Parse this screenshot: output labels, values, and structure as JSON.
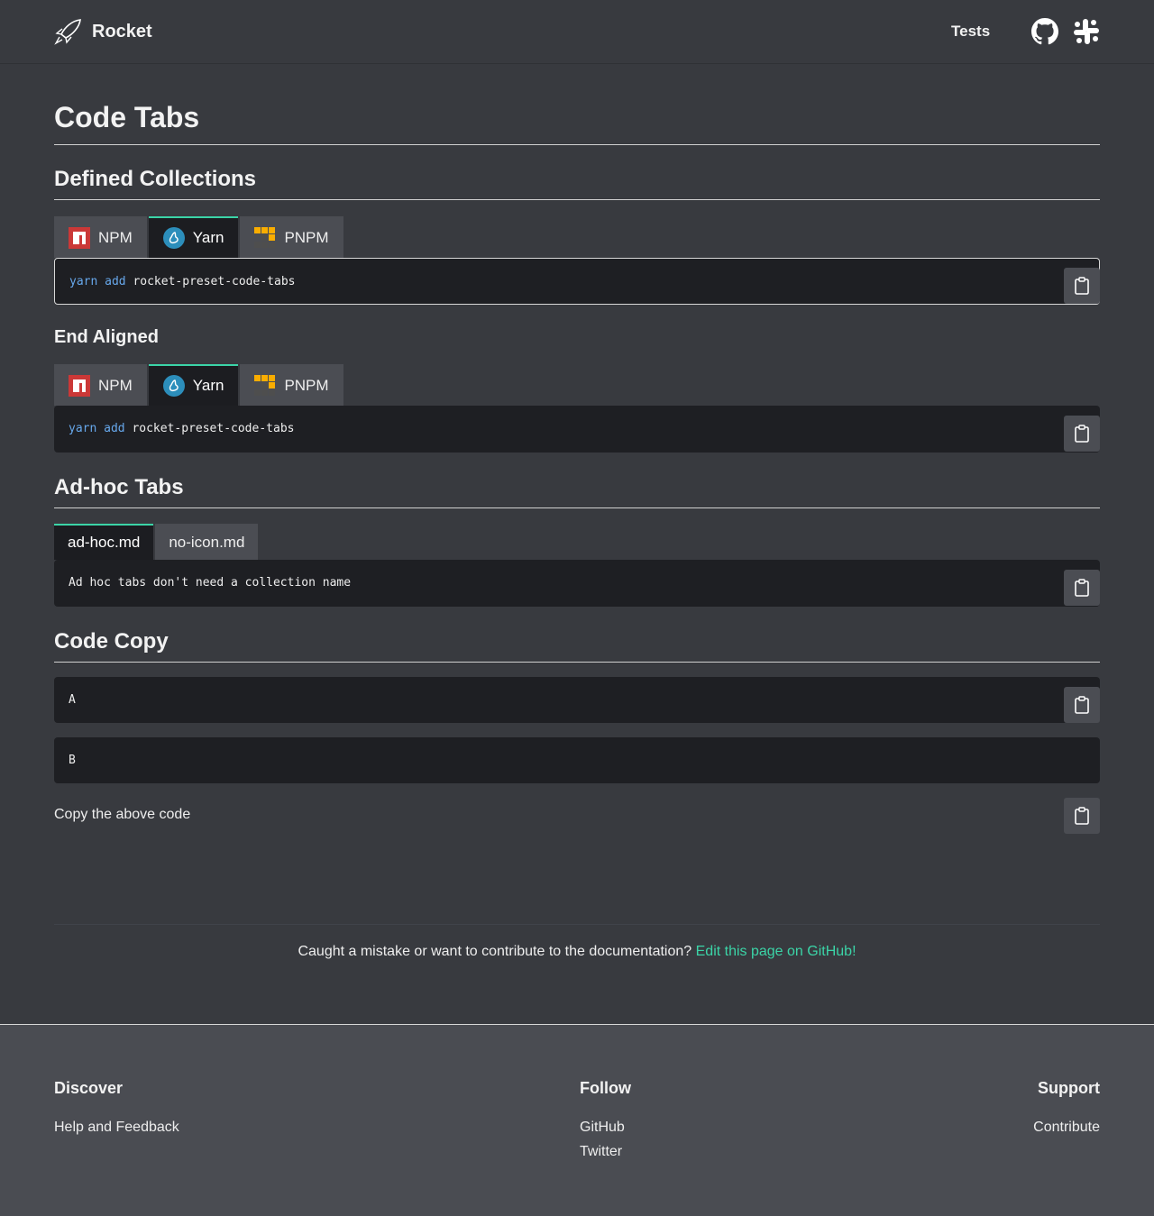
{
  "header": {
    "brand": "Rocket",
    "nav_tests": "Tests",
    "icons": [
      "rocket-logo-icon",
      "github-icon",
      "slack-icon"
    ]
  },
  "page": {
    "title": "Code Tabs",
    "sections": {
      "defined_collections": "Defined Collections",
      "end_aligned": "End Aligned",
      "adhoc_tabs": "Ad-hoc Tabs",
      "code_copy": "Code Copy"
    }
  },
  "collections_tabs": {
    "npm": "NPM",
    "yarn": "Yarn",
    "pnpm": "PNPM",
    "active": "Yarn"
  },
  "yarn_command": {
    "cmd": "yarn",
    "sub": "add",
    "pkg": "rocket-preset-code-tabs"
  },
  "adhoc": {
    "tab1": "ad-hoc.md",
    "tab2": "no-icon.md",
    "content": "Ad hoc tabs don't need a collection name"
  },
  "code_copy": {
    "block_a": "A",
    "block_b": "B",
    "copy_text": "Copy the above code"
  },
  "contribute": {
    "text": "Caught a mistake or want to contribute to the documentation?",
    "link": "Edit this page on GitHub!"
  },
  "footer": {
    "discover": {
      "title": "Discover",
      "links": [
        "Help and Feedback"
      ]
    },
    "follow": {
      "title": "Follow",
      "links": [
        "GitHub",
        "Twitter"
      ]
    },
    "support": {
      "title": "Support",
      "links": [
        "Contribute"
      ]
    }
  },
  "colors": {
    "accent": "#3bd4a7",
    "background": "#383a3f",
    "code_bg": "#1e1f23",
    "footer_bg": "#4a4c52",
    "keyword": "#67a8ec"
  }
}
